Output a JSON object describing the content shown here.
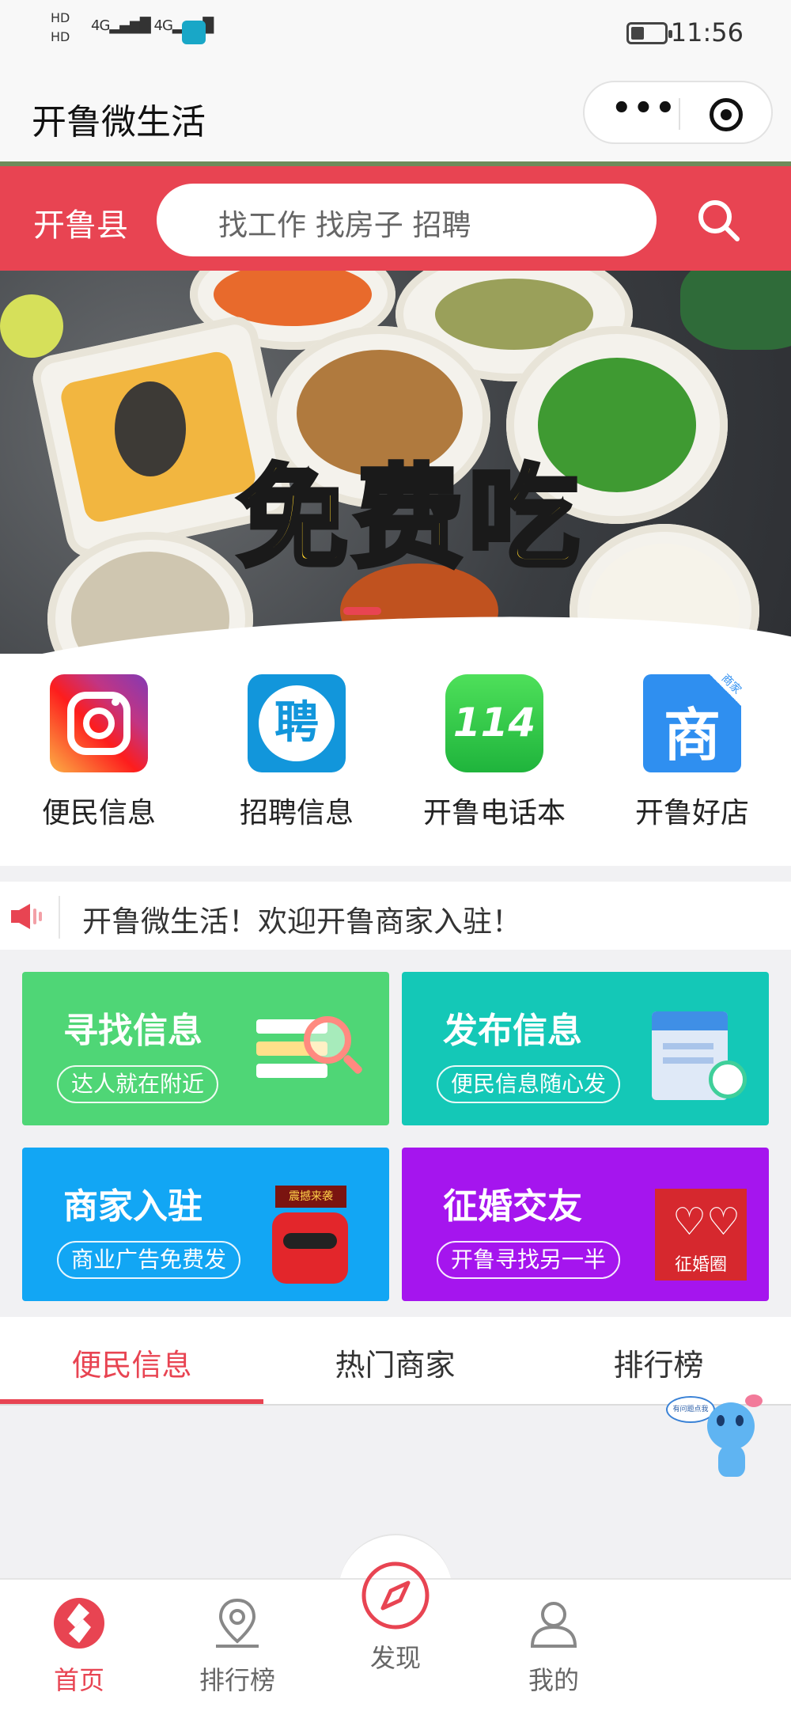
{
  "status_bar": {
    "hd_top": "HD",
    "hd_bottom": "HD",
    "signal1": "4G",
    "signal2": "4G",
    "time": "11:56"
  },
  "titlebar": {
    "title": "开鲁微生活"
  },
  "search": {
    "city": "开鲁县",
    "placeholder": "找工作 找房子 招聘"
  },
  "banner": {
    "headline": "免费吃"
  },
  "quick_links": [
    {
      "label": "便民信息",
      "icon": "instagram-icon",
      "badge": ""
    },
    {
      "label": "招聘信息",
      "icon": "recruit-icon",
      "glyph": "聘"
    },
    {
      "label": "开鲁电话本",
      "icon": "phonebook-114-icon",
      "glyph": "114"
    },
    {
      "label": "开鲁好店",
      "icon": "shop-icon",
      "glyph": "商",
      "badge": "商家"
    }
  ],
  "notice": {
    "text": "开鲁微生活！欢迎开鲁商家入驻！"
  },
  "cards": [
    {
      "title": "寻找信息",
      "subtitle": "达人就在附近",
      "color": "#4fd676"
    },
    {
      "title": "发布信息",
      "subtitle": "便民信息随心发",
      "color": "#14c8b7"
    },
    {
      "title": "商家入驻",
      "subtitle": "商业广告免费发",
      "color": "#12a6f4",
      "art_text": "震撼来袭"
    },
    {
      "title": "征婚交友",
      "subtitle": "开鲁寻找另一半",
      "color": "#a515ee",
      "art_text": "征婚圈"
    }
  ],
  "tabs": [
    {
      "label": "便民信息",
      "active": true
    },
    {
      "label": "热门商家",
      "active": false
    },
    {
      "label": "排行榜",
      "active": false
    }
  ],
  "mascot": {
    "bubble": "有问题点我"
  },
  "bottom_nav": [
    {
      "label": "首页",
      "icon": "home-logo-icon",
      "active": true
    },
    {
      "label": "排行榜",
      "icon": "location-pin-icon",
      "active": false
    },
    {
      "label": "发现",
      "icon": "compass-icon",
      "active": false
    },
    {
      "label": "我的",
      "icon": "user-icon",
      "active": false
    }
  ],
  "colors": {
    "accent": "#e84452"
  }
}
